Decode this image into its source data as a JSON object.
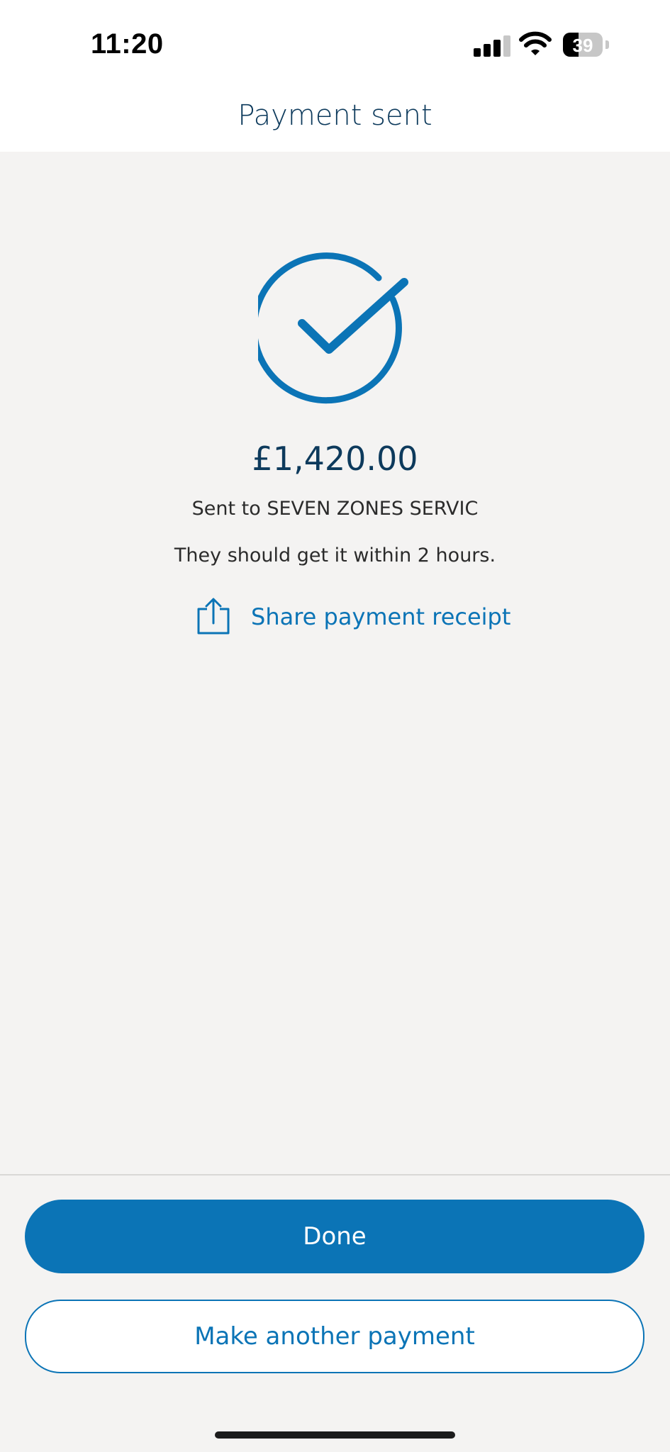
{
  "status_bar": {
    "time": "11:20",
    "battery_level": "39",
    "icons": [
      "cellular-signal-icon",
      "wifi-icon",
      "battery-icon"
    ]
  },
  "header": {
    "title": "Payment sent"
  },
  "confirmation": {
    "icon": "check-circle-icon",
    "amount": "£1,420.00",
    "recipient_text": "Sent to SEVEN ZONES SERVIC",
    "eta_text": "They should get it within 2 hours.",
    "share_label": "Share payment receipt",
    "share_icon": "share-icon"
  },
  "actions": {
    "done_label": "Done",
    "another_label": "Make another payment"
  },
  "colors": {
    "accent": "#0b74b6",
    "title": "#0d3a5c",
    "background": "#f4f3f2"
  }
}
